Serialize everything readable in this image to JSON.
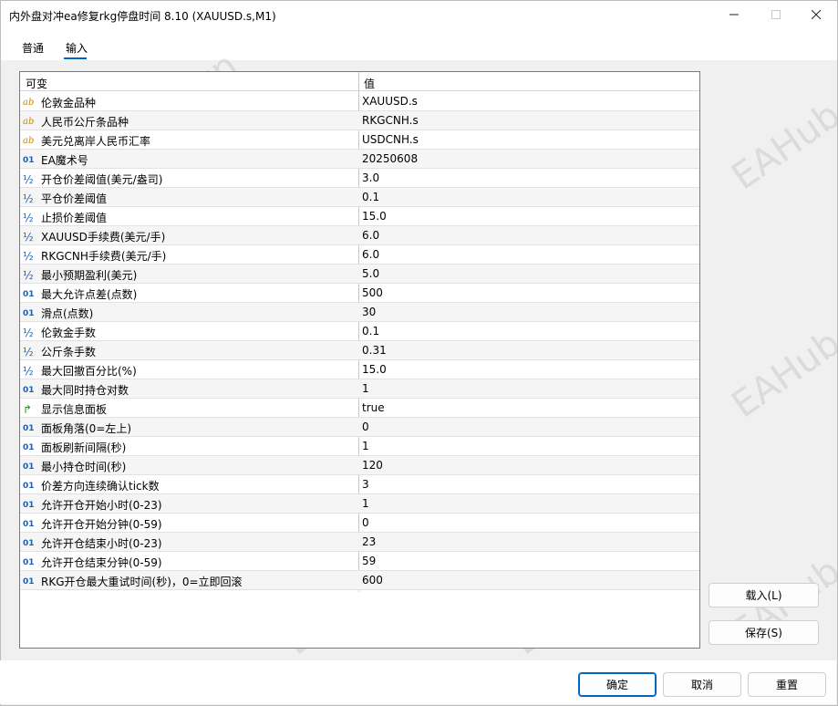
{
  "window": {
    "title": "内外盘对冲ea修复rkg停盘时间 8.10 (XAUUSD.s,M1)"
  },
  "tabs": [
    {
      "label": "普通"
    },
    {
      "label": "输入",
      "active": true
    }
  ],
  "table": {
    "headers": {
      "name": "可变",
      "value": "值"
    },
    "rows": [
      {
        "icon": "ab",
        "name": "伦敦金品种",
        "value": "XAUUSD.s"
      },
      {
        "icon": "ab",
        "name": "人民币公斤条品种",
        "value": "RKGCNH.s"
      },
      {
        "icon": "ab",
        "name": "美元兑离岸人民币汇率",
        "value": "USDCNH.s"
      },
      {
        "icon": "01",
        "name": "EA魔术号",
        "value": "20250608"
      },
      {
        "icon": "½",
        "name": "开仓价差阈值(美元/盎司)",
        "value": "3.0"
      },
      {
        "icon": "½",
        "name": "平仓价差阈值",
        "value": "0.1"
      },
      {
        "icon": "½",
        "name": "止损价差阈值",
        "value": "15.0"
      },
      {
        "icon": "½",
        "name": "XAUUSD手续费(美元/手)",
        "value": "6.0"
      },
      {
        "icon": "½",
        "name": "RKGCNH手续费(美元/手)",
        "value": "6.0"
      },
      {
        "icon": "½",
        "name": "最小预期盈利(美元)",
        "value": "5.0"
      },
      {
        "icon": "01",
        "name": "最大允许点差(点数)",
        "value": "500"
      },
      {
        "icon": "01",
        "name": "滑点(点数)",
        "value": "30"
      },
      {
        "icon": "½",
        "name": "伦敦金手数",
        "value": "0.1"
      },
      {
        "icon": "½",
        "name": "公斤条手数",
        "value": "0.31"
      },
      {
        "icon": "½",
        "name": "最大回撤百分比(%)",
        "value": "15.0"
      },
      {
        "icon": "01",
        "name": "最大同时持仓对数",
        "value": "1"
      },
      {
        "icon": "bool",
        "name": "显示信息面板",
        "value": "true"
      },
      {
        "icon": "01",
        "name": "面板角落(0=左上)",
        "value": "0"
      },
      {
        "icon": "01",
        "name": "面板刷新间隔(秒)",
        "value": "1"
      },
      {
        "icon": "01",
        "name": "最小持仓时间(秒)",
        "value": "120"
      },
      {
        "icon": "01",
        "name": "价差方向连续确认tick数",
        "value": "3"
      },
      {
        "icon": "01",
        "name": "允许开仓开始小时(0-23)",
        "value": "1"
      },
      {
        "icon": "01",
        "name": "允许开仓开始分钟(0-59)",
        "value": "0"
      },
      {
        "icon": "01",
        "name": "允许开仓结束小时(0-23)",
        "value": "23"
      },
      {
        "icon": "01",
        "name": "允许开仓结束分钟(0-59)",
        "value": "59"
      },
      {
        "icon": "01",
        "name": "RKG开仓最大重试时间(秒)，0=立即回滚",
        "value": "600"
      }
    ]
  },
  "side_buttons": {
    "load": "载入(L)",
    "save": "保存(S)"
  },
  "footer_buttons": {
    "ok": "确定",
    "cancel": "取消",
    "reset": "重置"
  },
  "watermark_text": "EAHub.cn"
}
